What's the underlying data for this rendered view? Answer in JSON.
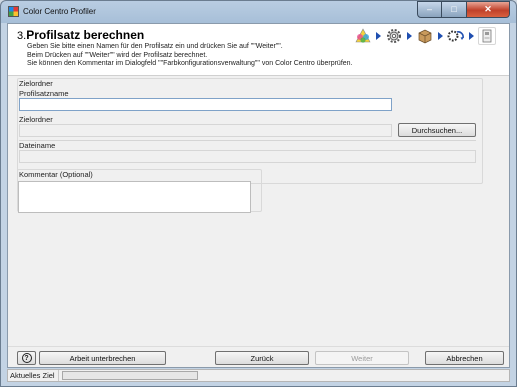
{
  "window": {
    "title": "Color Centro Profiler",
    "minimize_glyph": "–",
    "maximize_glyph": "□",
    "close_glyph": "✕"
  },
  "header": {
    "step_number": "3.",
    "step_title": "Profilsatz berechnen",
    "description": [
      "Geben Sie bitte einen Namen für den Profilsatz ein und drücken Sie auf \"\"Weiter\"\".",
      "Beim Drücken auf \"\"Weiter\"\" wird der Profilsatz berechnet.",
      "Sie können den Kommentar im Dialogfeld \"\"Farbkonfigurationsverwaltung\"\" von Color Centro überprüfen."
    ],
    "wizard_steps": [
      "color-wheel-icon",
      "gear-icon",
      "box-icon",
      "process-icon",
      "device-icon"
    ],
    "current_step_index": 4
  },
  "form": {
    "group_label": "Zielordner",
    "profile_name_label": "Profilsatzname",
    "profile_name_value": "",
    "target_folder_label": "Zielordner",
    "target_folder_value": "",
    "browse_label": "Durchsuchen...",
    "filename_label": "Dateiname",
    "filename_value": "",
    "comment_label": "Kommentar (Optional)",
    "comment_value": ""
  },
  "footer": {
    "help_glyph": "?",
    "interrupt_label": "Arbeit unterbrechen",
    "back_label": "Zurück",
    "next_label": "Weiter",
    "cancel_label": "Abbrechen"
  },
  "status": {
    "label": "Aktuelles Ziel",
    "progress": 0
  },
  "colors": {
    "accent": "#1f4fb0",
    "close_button": "#c0412a",
    "progress_fill": "#3cb043"
  }
}
